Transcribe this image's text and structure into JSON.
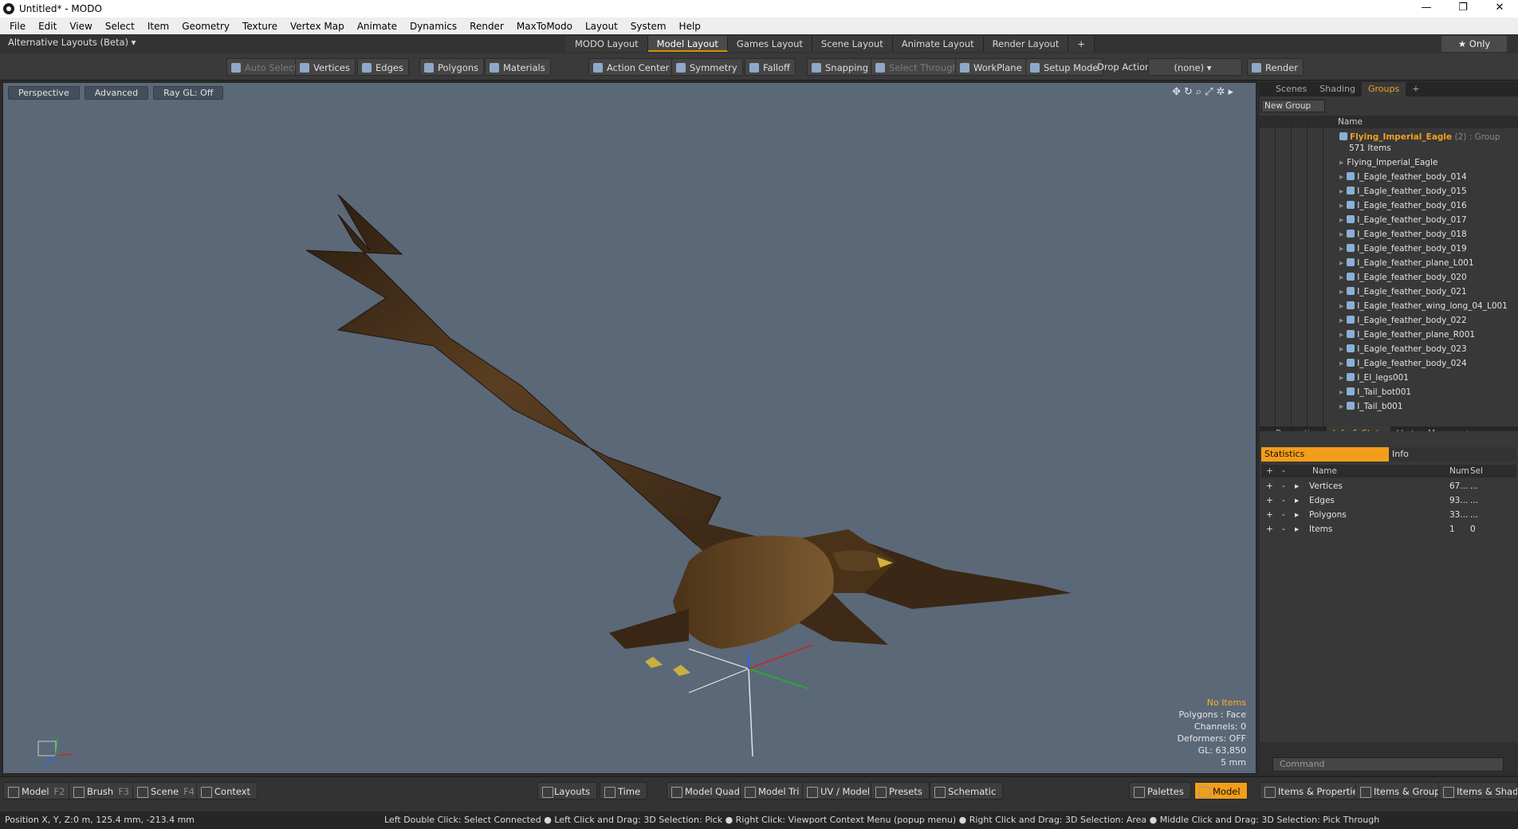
{
  "window": {
    "title": "Untitled* - MODO",
    "controls": [
      "—",
      "❐",
      "✕"
    ]
  },
  "menu": [
    "File",
    "Edit",
    "View",
    "Select",
    "Item",
    "Geometry",
    "Texture",
    "Vertex Map",
    "Animate",
    "Dynamics",
    "Render",
    "MaxToModo",
    "Layout",
    "System",
    "Help"
  ],
  "layoutbar": {
    "alt_layouts": "Alternative Layouts (Beta) ▾",
    "tabs": [
      "MODO Layout",
      "Model Layout",
      "Games Layout",
      "Scene Layout",
      "Animate Layout",
      "Render Layout",
      "+"
    ],
    "only": "★ Only"
  },
  "toolbar": {
    "auto_select": "Auto Select",
    "vertices": "Vertices",
    "edges": "Edges",
    "polygons": "Polygons",
    "materials": "Materials",
    "action_center": "Action Center",
    "symmetry": "Symmetry",
    "falloff": "Falloff",
    "snapping": "Snapping",
    "select_through": "Select Through",
    "workplane": "WorkPlane",
    "setup_mode": "Setup Mode",
    "drop_action": "Drop Action",
    "drop_value": "(none)",
    "render": "Render"
  },
  "viewport": {
    "perspective": "Perspective",
    "advanced": "Advanced",
    "raygl": "Ray GL: Off",
    "icons": "✥↻⌕⤢✲▸",
    "overlay": {
      "status": "No Items",
      "polygons": "Polygons : Face",
      "channels": "Channels: 0",
      "deformers": "Deformers: OFF",
      "gl": "GL: 63,850",
      "scale": "5 mm"
    }
  },
  "groups_panel": {
    "tabs": [
      "Scenes",
      "Shading",
      "Groups",
      "+"
    ],
    "new_group": "New Group",
    "name_header": "Name",
    "group_name": "Flying_Imperial_Eagle",
    "group_suffix": "(2) : Group",
    "item_count": "571 Items",
    "items": [
      "Flying_Imperial_Eagle",
      "I_Eagle_feather_body_014",
      "I_Eagle_feather_body_015",
      "I_Eagle_feather_body_016",
      "I_Eagle_feather_body_017",
      "I_Eagle_feather_body_018",
      "I_Eagle_feather_body_019",
      "I_Eagle_feather_plane_L001",
      "I_Eagle_feather_body_020",
      "I_Eagle_feather_body_021",
      "I_Eagle_feather_wing_long_04_L001",
      "I_Eagle_feather_body_022",
      "I_Eagle_feather_plane_R001",
      "I_Eagle_feather_body_023",
      "I_Eagle_feather_body_024",
      "I_El_legs001",
      "I_Tail_bot001",
      "I_Tail_b001"
    ]
  },
  "info_panel": {
    "tabs": [
      "Properties",
      "Info & Stats",
      "Vertex Maps",
      "+"
    ],
    "subtabs": [
      "Statistics",
      "Info"
    ],
    "headers": {
      "name": "Name",
      "num": "Num",
      "sel": "Sel"
    },
    "rows": [
      {
        "name": "Vertices",
        "num": "67...",
        "sel": "..."
      },
      {
        "name": "Edges",
        "num": "93...",
        "sel": "..."
      },
      {
        "name": "Polygons",
        "num": "33...",
        "sel": "..."
      },
      {
        "name": "Items",
        "num": "1",
        "sel": "0"
      }
    ]
  },
  "command": {
    "placeholder": "Command"
  },
  "bottombar": {
    "model": "Model",
    "f2": "F2",
    "brush": "Brush",
    "f3": "F3",
    "scene": "Scene",
    "f4": "F4",
    "context": "Context",
    "layouts": "Layouts",
    "time": "Time",
    "model_quad": "Model Quad",
    "model_tri": "Model Tri",
    "uv_model": "UV / Model",
    "presets": "Presets",
    "schematic": "Schematic",
    "palettes": "Palettes",
    "model_on": "Model",
    "items_props": "Items & Properties",
    "items_groups": "Items & Groups",
    "items_shading": "Items & Shading"
  },
  "statusbar": {
    "position_label": "Position X, Y, Z:",
    "position_value": "0 m, 125.4 mm, -213.4 mm",
    "hints": "Left Double Click: Select Connected ● Left Click and Drag: 3D Selection: Pick ● Right Click: Viewport Context Menu (popup menu) ● Right Click and Drag: 3D Selection: Area ● Middle Click and Drag: 3D Selection: Pick Through"
  }
}
